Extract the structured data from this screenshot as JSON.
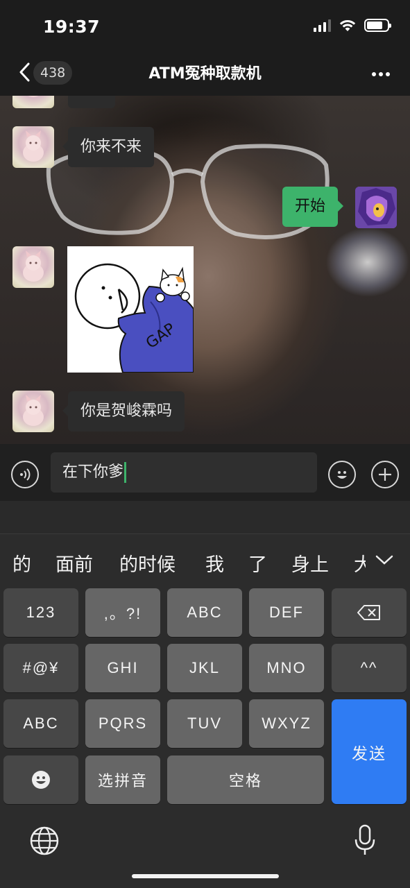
{
  "status_bar": {
    "time": "19:37",
    "battery_level": 0.8
  },
  "header": {
    "unread_count": "438",
    "title": "ATM冤种取款机"
  },
  "messages": [
    {
      "side": "in",
      "type": "text",
      "text": "你来不来"
    },
    {
      "side": "out",
      "type": "text",
      "text": "开始"
    },
    {
      "side": "in",
      "type": "sticker",
      "sticker_text": "GAP"
    },
    {
      "side": "in",
      "type": "text",
      "text": "你是贺峻霖吗"
    }
  ],
  "input": {
    "value": "在下你爹"
  },
  "keyboard": {
    "candidates": [
      "的",
      "面前",
      "的时候",
      "我",
      "了",
      "身上",
      "大"
    ],
    "rows": [
      [
        "123",
        ",。?!",
        "ABC",
        "DEF"
      ],
      [
        "#@¥",
        "GHI",
        "JKL",
        "MNO",
        "^^"
      ],
      [
        "ABC",
        "PQRS",
        "TUV",
        "WXYZ"
      ],
      [
        "选拼音",
        "空格"
      ]
    ],
    "send_label": "发送"
  },
  "colors": {
    "sent_bubble": "#3db36b",
    "send_key": "#2f7cf3",
    "received_bubble": "#2c2c2c"
  },
  "icons": [
    "back-icon",
    "more-icon",
    "voice-icon",
    "emoji-icon",
    "plus-icon",
    "backspace-icon",
    "chevron-down-icon",
    "globe-icon",
    "mic-icon",
    "emoji-key-icon"
  ]
}
